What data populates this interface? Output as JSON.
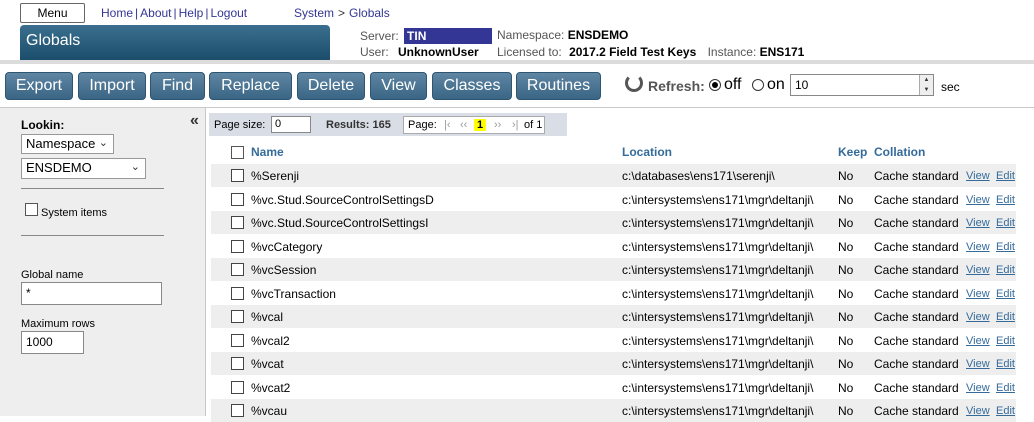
{
  "header": {
    "menu_label": "Menu",
    "links": [
      "Home",
      "About",
      "Help",
      "Logout"
    ],
    "breadcrumb": [
      "System",
      "Globals"
    ],
    "page_title": "Globals",
    "server_label": "Server:",
    "server_value": "TIN",
    "user_label": "User:",
    "user_value": "UnknownUser",
    "namespace_label": "Namespace:",
    "namespace_value": "ENSDEMO",
    "licensed_label": "Licensed to:",
    "licensed_value": "2017.2 Field Test Keys",
    "instance_label": "Instance:",
    "instance_value": "ENS171"
  },
  "toolbar": {
    "buttons": [
      "Export",
      "Import",
      "Find",
      "Replace",
      "Delete",
      "View",
      "Classes",
      "Routines"
    ],
    "refresh_label": "Refresh:",
    "off_label": "off",
    "on_label": "on",
    "refresh_value": "10",
    "sec_label": "sec",
    "selected": "off"
  },
  "left": {
    "lookin_label": "Lookin:",
    "lookin_type": "Namespace",
    "lookin_value": "ENSDEMO",
    "system_items_label": "System items",
    "global_name_label": "Global name",
    "global_name_value": "*",
    "max_rows_label": "Maximum rows",
    "max_rows_value": "1000"
  },
  "pager": {
    "page_size_label": "Page size:",
    "page_size_value": "0",
    "results_label": "Results: 165",
    "page_label": "Page:",
    "first": "|‹",
    "prev": "‹‹",
    "current": "1",
    "next": "››",
    "last": "›|",
    "of_label": "of 1"
  },
  "table": {
    "columns": {
      "name": "Name",
      "location": "Location",
      "keep": "Keep",
      "collation": "Collation"
    },
    "rows": [
      {
        "name": "%Serenji",
        "location": "c:\\databases\\ens171\\serenji\\",
        "keep": "No",
        "collation": "Cache standard",
        "view": "View",
        "edit": "Edit"
      },
      {
        "name": "%vc.Stud.SourceControlSettingsD",
        "location": "c:\\intersystems\\ens171\\mgr\\deltanji\\",
        "keep": "No",
        "collation": "Cache standard",
        "view": "View",
        "edit": "Edit"
      },
      {
        "name": "%vc.Stud.SourceControlSettingsI",
        "location": "c:\\intersystems\\ens171\\mgr\\deltanji\\",
        "keep": "No",
        "collation": "Cache standard",
        "view": "View",
        "edit": "Edit"
      },
      {
        "name": "%vcCategory",
        "location": "c:\\intersystems\\ens171\\mgr\\deltanji\\",
        "keep": "No",
        "collation": "Cache standard",
        "view": "View",
        "edit": "Edit"
      },
      {
        "name": "%vcSession",
        "location": "c:\\intersystems\\ens171\\mgr\\deltanji\\",
        "keep": "No",
        "collation": "Cache standard",
        "view": "View",
        "edit": "Edit"
      },
      {
        "name": "%vcTransaction",
        "location": "c:\\intersystems\\ens171\\mgr\\deltanji\\",
        "keep": "No",
        "collation": "Cache standard",
        "view": "View",
        "edit": "Edit"
      },
      {
        "name": "%vcal",
        "location": "c:\\intersystems\\ens171\\mgr\\deltanji\\",
        "keep": "No",
        "collation": "Cache standard",
        "view": "View",
        "edit": "Edit"
      },
      {
        "name": "%vcal2",
        "location": "c:\\intersystems\\ens171\\mgr\\deltanji\\",
        "keep": "No",
        "collation": "Cache standard",
        "view": "View",
        "edit": "Edit"
      },
      {
        "name": "%vcat",
        "location": "c:\\intersystems\\ens171\\mgr\\deltanji\\",
        "keep": "No",
        "collation": "Cache standard",
        "view": "View",
        "edit": "Edit"
      },
      {
        "name": "%vcat2",
        "location": "c:\\intersystems\\ens171\\mgr\\deltanji\\",
        "keep": "No",
        "collation": "Cache standard",
        "view": "View",
        "edit": "Edit"
      },
      {
        "name": "%vcau",
        "location": "c:\\intersystems\\ens171\\mgr\\deltanji\\",
        "keep": "No",
        "collation": "Cache standard",
        "view": "View",
        "edit": "Edit"
      }
    ]
  }
}
